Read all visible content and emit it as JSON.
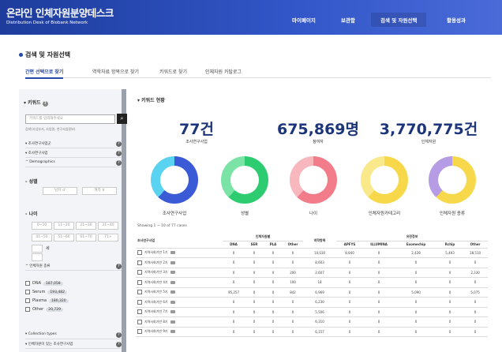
{
  "header": {
    "title": "온라인 인체자원분양데스크",
    "subtitle": "Distribution Desk of Biobank Network",
    "nav": [
      "마이페이지",
      "보관함",
      "검색 및 자원선택",
      "활용성과"
    ]
  },
  "page": {
    "title": "검색 및 자원선택",
    "tabs": [
      "간편 선택으로 찾기",
      "역학자료 항목으로 찾기",
      "키워드로 찾기",
      "인체자원 카탈로그"
    ]
  },
  "sidebar": {
    "keyword_title": "키워드",
    "keyword_placeholder": "키워드를 입력해주세요",
    "search_icon": "magnifier-icon",
    "keyword_hint": "검색(사업부서, 사업명, 연구사업정보)",
    "acc_top": [
      "조사연구사업군",
      "조사연구사업",
      "Demographics"
    ],
    "gender_title": "성별",
    "gender": [
      "남자 ♂",
      "여자 ♀"
    ],
    "age_title": "나이",
    "ages": [
      "0~10",
      "11~20",
      "21~30",
      "31~40",
      "41~50",
      "51~60",
      "61~70",
      "71+"
    ],
    "age_extra": "세",
    "resource_type": "인체자원 종류",
    "resources": [
      {
        "name": "DNA",
        "count": "187,058"
      },
      {
        "name": "Serum",
        "count": "193,482"
      },
      {
        "name": "Plasma",
        "count": "180,320"
      },
      {
        "name": "Other",
        "count": "20,729"
      }
    ],
    "acc_bottom": [
      "Collection types",
      "인체자원이 있는 조사연구사업"
    ]
  },
  "stats": {
    "section_title": "키워드 현황",
    "items": [
      {
        "value": "77건",
        "label": "조사연구사업"
      },
      {
        "value": "675,869명",
        "label": "참여자"
      },
      {
        "value": "3,770,775건",
        "label": "인체자원"
      }
    ]
  },
  "donuts": [
    {
      "label": "조사연구사업",
      "colors": [
        "#3b5bd6",
        "#5ad3f0"
      ]
    },
    {
      "label": "성별",
      "colors": [
        "#2ecc71",
        "#7be3a5"
      ]
    },
    {
      "label": "나이",
      "colors": [
        "#f27c8a",
        "#f8b6bd"
      ]
    },
    {
      "label": "인체자원카테고리",
      "colors": [
        "#f6d84a",
        "#f9e98a"
      ]
    },
    {
      "label": "인체자원 종류",
      "colors": [
        "#f6d84a",
        "#b59ce5"
      ]
    }
  ],
  "table": {
    "showing": "Showing 1 ~ 10 of 77 cases",
    "col_project": "조사연구사업",
    "grp_resource": "인체자원별",
    "grp_epi": "역학항목",
    "grp_genome": "유전정보",
    "cols": [
      "DNA",
      "SER",
      "PLA",
      "Other",
      "APFYS",
      "ILLUMINA",
      "Exomechip",
      "Rchip",
      "Other"
    ],
    "rows": [
      {
        "name": "지역사회기반 1기",
        "v": [
          "0",
          "0",
          "0",
          "0",
          "10,030",
          "8,840",
          "0",
          "2,428",
          "5,493",
          "38,510"
        ]
      },
      {
        "name": "지역사회기반 2기",
        "v": [
          "0",
          "0",
          "0",
          "0",
          "8,603",
          "0",
          "0",
          "0",
          "0",
          "0"
        ]
      },
      {
        "name": "지역사회기반 3기",
        "v": [
          "0",
          "0",
          "0",
          "200",
          "2,607",
          "0",
          "0",
          "0",
          "0",
          "2,330"
        ]
      },
      {
        "name": "지역사회기반 4기",
        "v": [
          "0",
          "0",
          "0",
          "100",
          "18",
          "0",
          "0",
          "0",
          "0",
          "0"
        ]
      },
      {
        "name": "지역사회기반 5기",
        "v": [
          "95,257",
          "0",
          "0",
          "842",
          "6,969",
          "0",
          "0",
          "5,090",
          "0",
          "5,075"
        ]
      },
      {
        "name": "지역사회기반 6기",
        "v": [
          "0",
          "0",
          "0",
          "0",
          "6,230",
          "0",
          "0",
          "0",
          "0",
          "0"
        ]
      },
      {
        "name": "지역사회기반 7기",
        "v": [
          "0",
          "0",
          "0",
          "0",
          "5,506",
          "0",
          "0",
          "0",
          "0",
          "0"
        ]
      },
      {
        "name": "지역사회기반 8기",
        "v": [
          "0",
          "0",
          "0",
          "0",
          "6,310",
          "0",
          "0",
          "0",
          "0",
          "0"
        ]
      },
      {
        "name": "지역사회기반 9기",
        "v": [
          "0",
          "0",
          "0",
          "0",
          "6,157",
          "0",
          "0",
          "0",
          "0",
          "0"
        ]
      }
    ]
  }
}
